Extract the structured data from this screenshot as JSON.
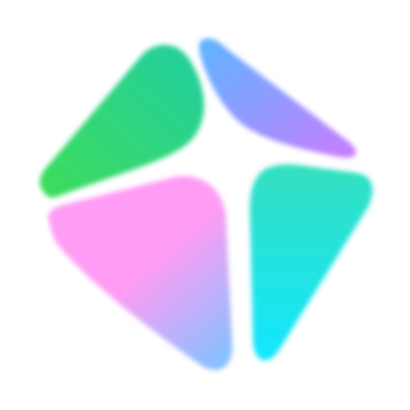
{
  "logo": {
    "icon": "app-logo-icon",
    "petals": [
      {
        "name": "petal-green",
        "gradient": [
          "#3ddc5a",
          "#22cfa0"
        ]
      },
      {
        "name": "petal-blue",
        "gradient": [
          "#5cb6ff",
          "#c97cff"
        ]
      },
      {
        "name": "petal-pink",
        "gradient": [
          "#ff9cf4",
          "#86c0ff"
        ]
      },
      {
        "name": "petal-cyan",
        "gradient": [
          "#33e0bf",
          "#14e6ff"
        ]
      }
    ]
  },
  "background_color": "#ffffff"
}
